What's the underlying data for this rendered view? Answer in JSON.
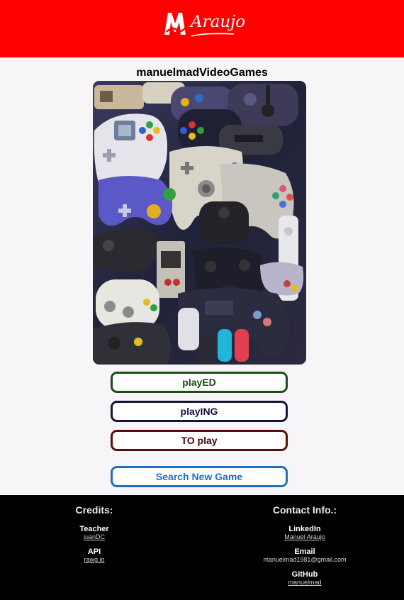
{
  "header": {
    "logo_text": "Araujo",
    "background_color": "#ff0000"
  },
  "site_title": "manuelmadVideoGames",
  "hero_image": {
    "alt": "collage of video game controllers"
  },
  "buttons": {
    "played": "playED",
    "playing": "playING",
    "to_play": "TO play",
    "search": "Search New Game"
  },
  "footer": {
    "credits": {
      "heading": "Credits:",
      "teacher_label": "Teacher",
      "teacher_link": "juanDC",
      "api_label": "API",
      "api_link": "rawg.io"
    },
    "contact": {
      "heading": "Contact Info.:",
      "linkedin_label": "LinkedIn",
      "linkedin_link": "Manuel Araujo",
      "email_label": "Email",
      "email_value": "manuelmad1981@gmail.com",
      "github_label": "GitHub",
      "github_link": "manuelmad"
    }
  },
  "colors": {
    "header": "#ff0000",
    "played": "#1a4e12",
    "playing": "#14143f",
    "to_play": "#5a0d0d",
    "search": "#1f6fc0",
    "footer": "#000000"
  }
}
